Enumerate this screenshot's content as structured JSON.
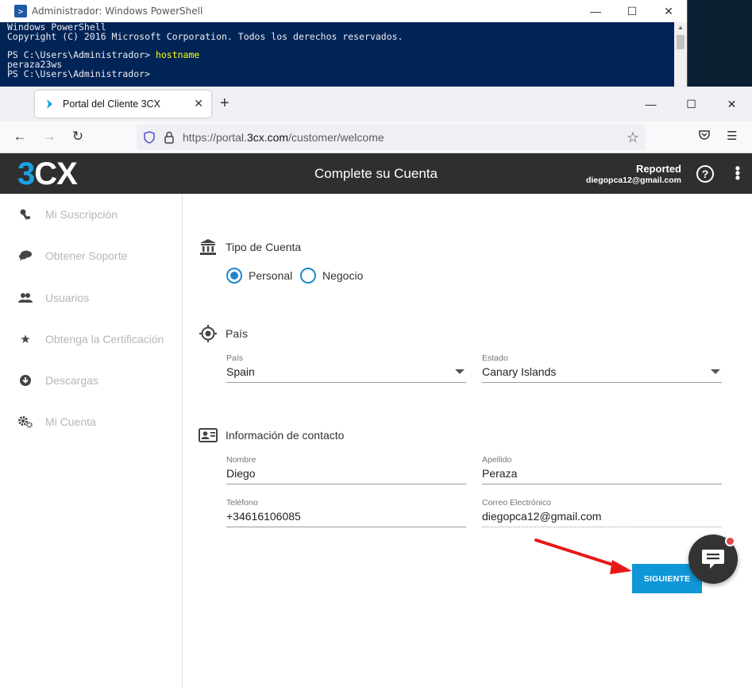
{
  "powershell": {
    "title": "Administrador: Windows PowerShell",
    "lines": [
      {
        "text": "Windows PowerShell",
        "cmd": ""
      },
      {
        "text": "Copyright (C) 2016 Microsoft Corporation. Todos los derechos reservados.",
        "cmd": ""
      },
      {
        "text": "",
        "cmd": ""
      },
      {
        "text": "PS C:\\Users\\Administrador> ",
        "cmd": "hostname"
      },
      {
        "text": "peraza23ws",
        "cmd": ""
      },
      {
        "text": "PS C:\\Users\\Administrador>",
        "cmd": ""
      }
    ]
  },
  "browser": {
    "tab_title": "Portal del Cliente 3CX",
    "url_prefix": "https://portal.",
    "url_domain": "3cx.com",
    "url_path": "/customer/welcome"
  },
  "header": {
    "logo_num": "3",
    "logo_text": "CX",
    "title": "Complete su Cuenta",
    "status": "Reported",
    "email": "diegopca12@gmail.com"
  },
  "sidebar": {
    "items": [
      {
        "label": "Mi Suscripción",
        "icon": "key-icon"
      },
      {
        "label": "Obtener Soporte",
        "icon": "chat-icon"
      },
      {
        "label": "Usuarios",
        "icon": "users-icon"
      },
      {
        "label": "Obtenga la Certificación",
        "icon": "star-icon"
      },
      {
        "label": "Descargas",
        "icon": "download-icon"
      },
      {
        "label": "Mi Cuenta",
        "icon": "gears-icon"
      }
    ]
  },
  "account_type": {
    "heading": "Tipo de Cuenta",
    "options": [
      {
        "label": "Personal",
        "selected": true
      },
      {
        "label": "Negocio",
        "selected": false
      }
    ]
  },
  "country": {
    "heading": "País",
    "country_label": "País",
    "country_value": "Spain",
    "state_label": "Estado",
    "state_value": "Canary Islands"
  },
  "contact": {
    "heading": "Información de contacto",
    "first_name_label": "Nombre",
    "first_name": "Diego",
    "last_name_label": "Apellido",
    "last_name": "Peraza",
    "phone_label": "Teléfono",
    "phone": "+34616106085",
    "email_label": "Correo Electrónico",
    "email": "diegopca12@gmail.com"
  },
  "actions": {
    "next_label": "SIGUIENTE"
  },
  "colors": {
    "accent": "#1e88c7",
    "button": "#0e96d6",
    "header_bg": "#2f2f2f",
    "annotation_arrow": "#e81818"
  }
}
